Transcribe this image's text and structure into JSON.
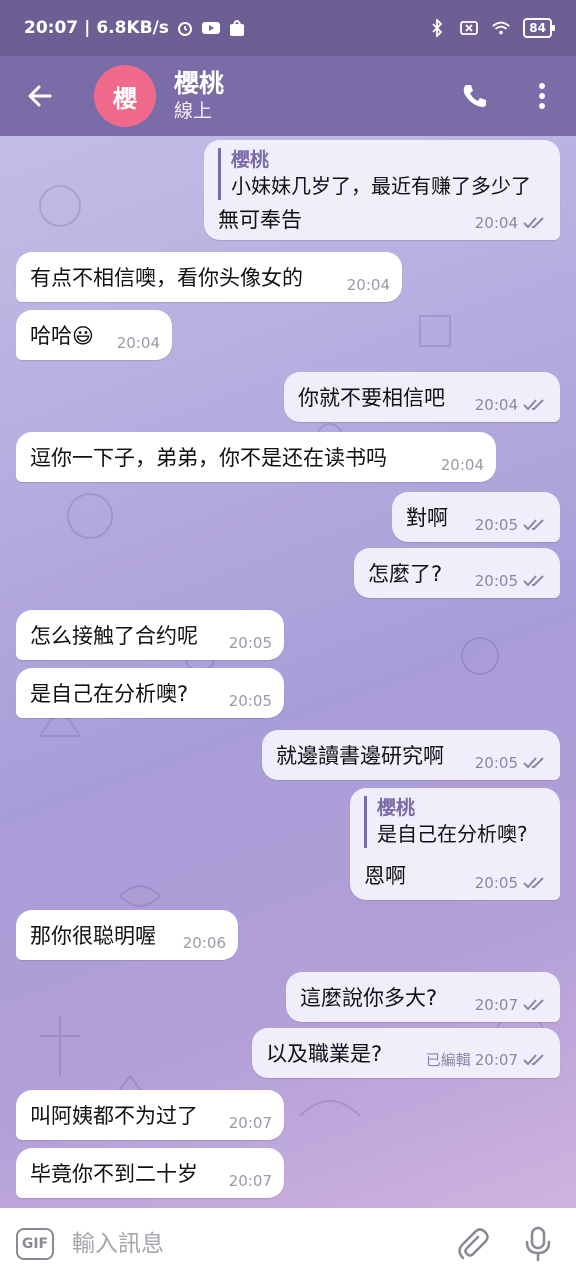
{
  "status_bar": {
    "time": "20:07",
    "net_speed": "6.8KB/s",
    "battery": "84"
  },
  "header": {
    "avatar_letter": "櫻",
    "contact_name": "櫻桃",
    "contact_status": "線上"
  },
  "messages": [
    {
      "dir": "out",
      "reply_name": "櫻桃",
      "reply_text": "小妹妹几岁了，最近有赚了多少了",
      "text": "無可奉告",
      "time": "20:04"
    },
    {
      "dir": "in",
      "text": "有点不相信噢，看你头像女的",
      "time": "20:04"
    },
    {
      "dir": "in",
      "text": "哈哈😃",
      "time": "20:04"
    },
    {
      "dir": "out",
      "text": "你就不要相信吧",
      "time": "20:04"
    },
    {
      "dir": "in",
      "text": "逗你一下子，弟弟，你不是还在读书吗",
      "time": "20:04"
    },
    {
      "dir": "out",
      "text": "對啊",
      "time": "20:05"
    },
    {
      "dir": "out",
      "text": "怎麼了?",
      "time": "20:05"
    },
    {
      "dir": "in",
      "text": "怎么接触了合约呢",
      "time": "20:05"
    },
    {
      "dir": "in",
      "text": "是自己在分析噢?",
      "time": "20:05"
    },
    {
      "dir": "out",
      "text": "就邊讀書邊研究啊",
      "time": "20:05"
    },
    {
      "dir": "out",
      "reply_name": "櫻桃",
      "reply_text": "是自己在分析噢?",
      "text": "恩啊",
      "time": "20:05"
    },
    {
      "dir": "in",
      "text": "那你很聪明喔",
      "time": "20:06"
    },
    {
      "dir": "out",
      "text": "這麼說你多大?",
      "time": "20:07"
    },
    {
      "dir": "out",
      "text": "以及職業是?",
      "edited": "已編輯",
      "time": "20:07"
    },
    {
      "dir": "in",
      "text": "叫阿姨都不为过了",
      "time": "20:07"
    },
    {
      "dir": "in",
      "text": "毕竟你不到二十岁",
      "time": "20:07"
    }
  ],
  "input": {
    "gif_label": "GIF",
    "placeholder": "輸入訊息"
  },
  "colors": {
    "status_bar": "#6c5f93",
    "header": "#7a6ca6",
    "avatar": "#f06b8b",
    "outgoing_bubble": "#f1eefb",
    "incoming_bubble": "#ffffff"
  },
  "icons": {
    "back": "arrow-left-icon",
    "call": "phone-icon",
    "more": "more-vertical-icon",
    "attach": "paperclip-icon",
    "voice": "microphone-icon",
    "read": "double-check-icon"
  }
}
